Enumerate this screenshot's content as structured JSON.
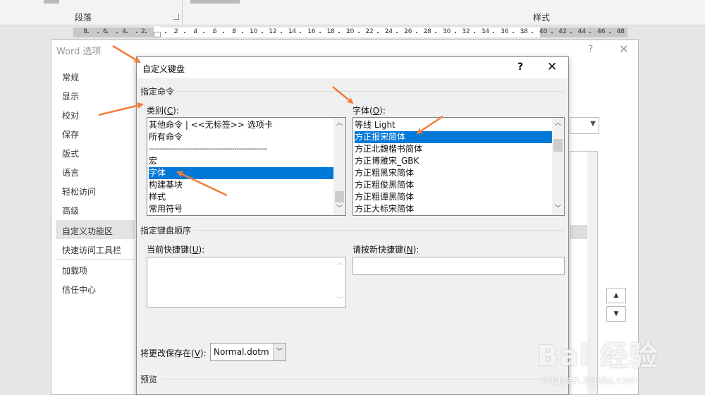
{
  "ribbon": {
    "paragraph_group": "段落",
    "styles_group": "样式"
  },
  "ruler": {
    "left_ticks": [
      "8",
      "6",
      "4",
      "2"
    ],
    "right_ticks": [
      "2",
      "4",
      "6",
      "8",
      "10",
      "12",
      "14",
      "16",
      "18",
      "20",
      "22",
      "24",
      "26",
      "28",
      "30",
      "32",
      "34",
      "36",
      "38",
      "40",
      "42",
      "44",
      "46",
      "48"
    ]
  },
  "word_options": {
    "title": "Word 选项",
    "help": "?",
    "close": "✕",
    "sidebar": [
      {
        "label": "常规"
      },
      {
        "label": "显示"
      },
      {
        "label": "校对"
      },
      {
        "label": "保存"
      },
      {
        "label": "版式"
      },
      {
        "label": "语言"
      },
      {
        "label": "轻松访问"
      },
      {
        "label": "高级"
      },
      {
        "label": "自定义功能区"
      },
      {
        "label": "快速访问工具栏"
      },
      {
        "label": "加载项"
      },
      {
        "label": "信任中心"
      }
    ],
    "selected_sidebar_item": "自定义功能区"
  },
  "dialog": {
    "title": "自定义键盘",
    "help": "?",
    "close": "✕",
    "specify_command": "指定命令",
    "categories_label": "类别",
    "categories_access": "C",
    "categories": [
      "其他命令 | <<无标签>> 选项卡",
      "所有命令",
      "------------------------------------------------------",
      "宏",
      "字体",
      "构建基块",
      "样式",
      "常用符号"
    ],
    "selected_category": "字体",
    "fonts_label": "字体",
    "fonts_access": "O",
    "fonts": [
      "等线 Light",
      "方正报宋简体",
      "方正北魏楷书简体",
      "方正博雅宋_GBK",
      "方正粗黑宋简体",
      "方正粗俊黑简体",
      "方正粗谭黑简体",
      "方正大标宋简体"
    ],
    "selected_font": "方正报宋简体",
    "specify_keyboard_sequence": "指定键盘顺序",
    "current_keys_label": "当前快捷键",
    "current_keys_access": "U",
    "new_key_label": "请按新快捷键",
    "new_key_access": "N",
    "new_key_value": "",
    "save_in_label": "将更改保存在",
    "save_in_access": "V",
    "save_in_value": "Normal.dotm",
    "preview_label": "预览"
  },
  "scroll_arrows": {
    "up": "▲",
    "down": "▼"
  },
  "watermark": {
    "logo": "Bai 经验",
    "url": "jingyan.baidu.com"
  },
  "colors": {
    "selection": "#0078d7",
    "annotation_arrow": "#f07d3c"
  }
}
